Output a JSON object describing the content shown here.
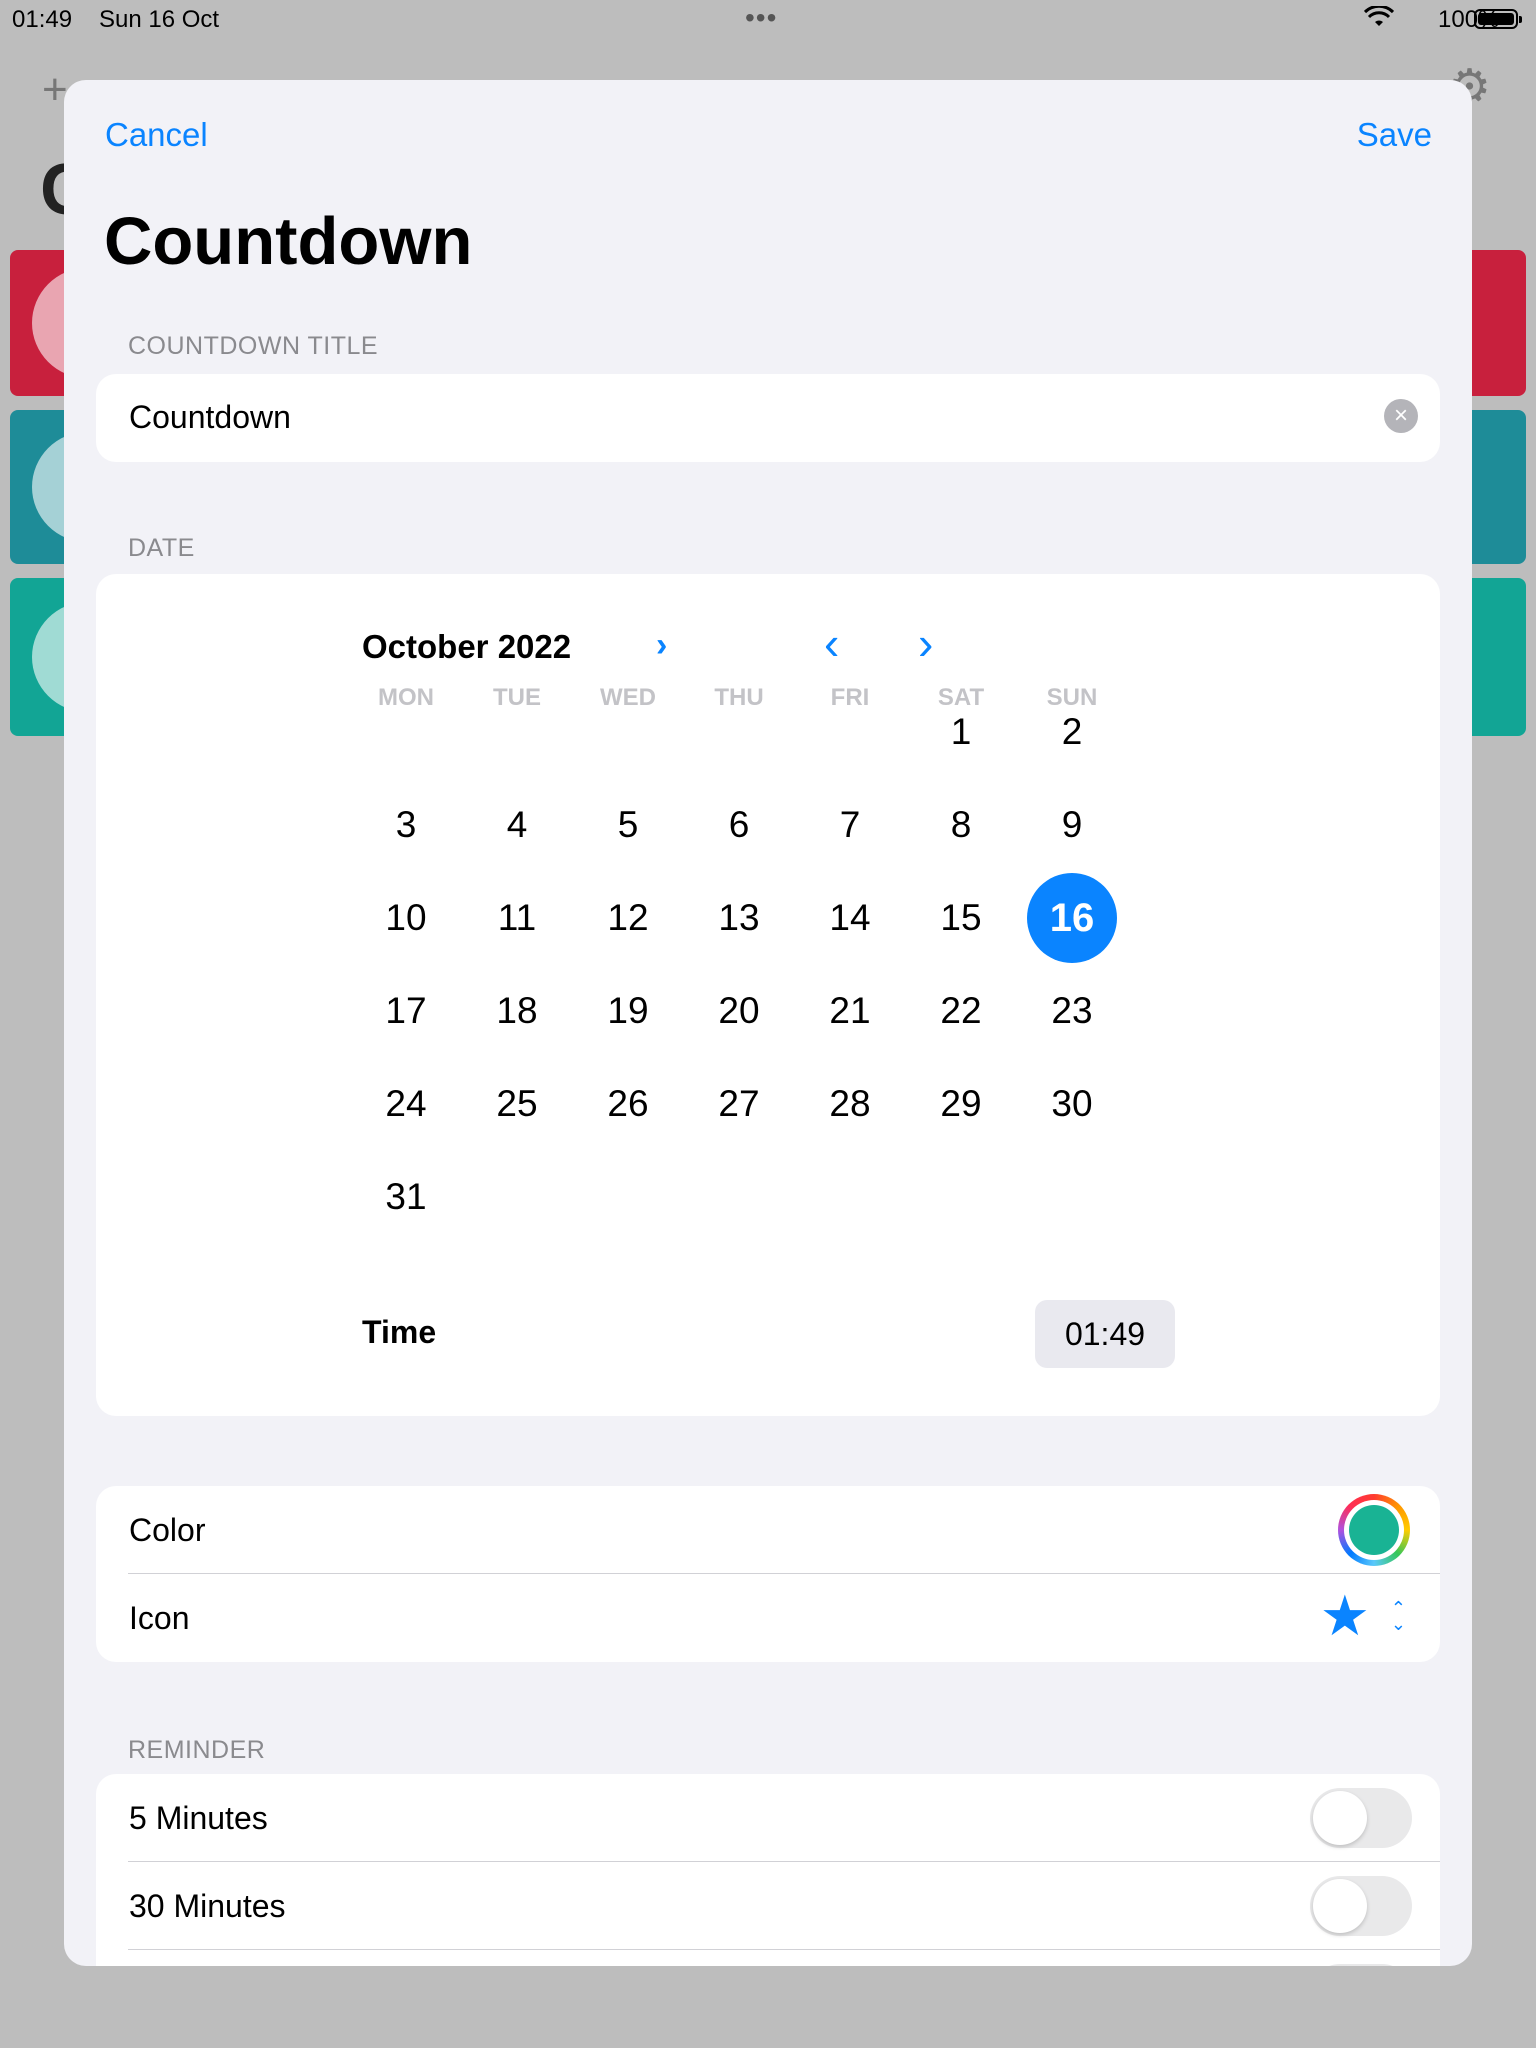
{
  "status_bar": {
    "time": "01:49",
    "date": "Sun 16 Oct",
    "dots": "•••",
    "battery": "100%"
  },
  "background": {
    "plus_icon": "+",
    "gear_icon": "⚙",
    "title_fragment": "C",
    "card_colors": [
      "#c8203d",
      "#1e8c98",
      "#12a595"
    ]
  },
  "sheet": {
    "cancel": "Cancel",
    "save": "Save",
    "title": "Countdown",
    "countdown_title_label": "COUNTDOWN TITLE",
    "countdown_title_value": "Countdown",
    "date_label": "DATE",
    "calendar": {
      "month": "October 2022",
      "weekdays": [
        "MON",
        "TUE",
        "WED",
        "THU",
        "FRI",
        "SAT",
        "SUN"
      ],
      "first_weekday_index": 5,
      "days_in_month": 31,
      "selected_day": "16",
      "time_label": "Time",
      "time_value": "01:49"
    },
    "options": {
      "color_label": "Color",
      "color_value": "#19b394",
      "icon_label": "Icon",
      "icon_name": "star-icon"
    },
    "reminder_label": "REMINDER",
    "reminders": [
      {
        "label": "5 Minutes",
        "on": false
      },
      {
        "label": "30 Minutes",
        "on": false
      }
    ]
  }
}
